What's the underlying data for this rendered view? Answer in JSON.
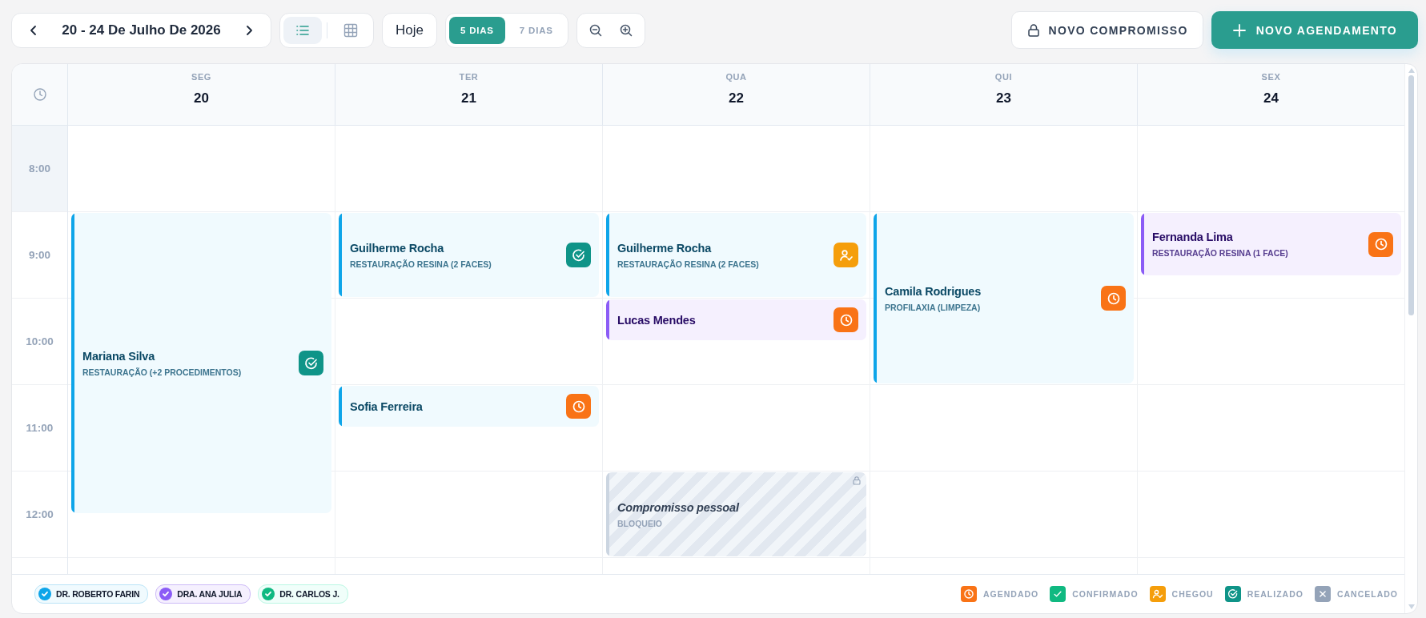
{
  "toolbar": {
    "range_label": "20 - 24 De Julho De 2026",
    "view_modes": [
      {
        "kind": "list",
        "selected": true
      },
      {
        "kind": "grid",
        "selected": false
      }
    ],
    "today_button": "Hoje",
    "day_spans": [
      {
        "label": "5 DIAS",
        "selected": true
      },
      {
        "label": "7 DIAS",
        "selected": false
      }
    ],
    "new_commitment_button": "NOVO COMPROMISSO",
    "new_appointment_button": "NOVO AGENDAMENTO"
  },
  "days": [
    {
      "weekday": "SEG",
      "date": "20",
      "quarters": [
        {
          "kind": "free"
        },
        {
          "kind": "free"
        },
        {
          "kind": "free"
        },
        {
          "kind": "free"
        },
        {
          "kind": "start"
        },
        {
          "kind": "cont"
        },
        {
          "kind": "cont"
        },
        {
          "kind": "cont"
        },
        {
          "kind": "cont"
        },
        {
          "kind": "cont"
        },
        {
          "kind": "cont"
        },
        {
          "kind": "cont"
        },
        {
          "kind": "cont"
        },
        {
          "kind": "cont"
        },
        {
          "kind": "cont"
        },
        {
          "kind": "cont"
        },
        {
          "kind": "cont"
        },
        {
          "kind": "cont"
        },
        {
          "kind": "free"
        },
        {
          "kind": "free"
        }
      ],
      "events": [
        {
          "kind": "appointment",
          "name": "Mariana Silva",
          "procedure": "RESTAURAÇÃO (+2 PROCEDIMENTOS)",
          "color": "#0ea5e9",
          "status": {
            "kind": "realizado"
          }
        }
      ]
    },
    {
      "weekday": "TER",
      "date": "21",
      "quarters": [
        {
          "kind": "free"
        },
        {
          "kind": "free"
        },
        {
          "kind": "free"
        },
        {
          "kind": "free"
        },
        {
          "kind": "start"
        },
        {
          "kind": "cont"
        },
        {
          "kind": "cont"
        },
        {
          "kind": "cont"
        },
        {
          "kind": "free"
        },
        {
          "kind": "free"
        },
        {
          "kind": "free"
        },
        {
          "kind": "free"
        },
        {
          "kind": "start"
        },
        {
          "kind": "cont"
        },
        {
          "kind": "free"
        },
        {
          "kind": "free"
        },
        {
          "kind": "free"
        },
        {
          "kind": "free"
        },
        {
          "kind": "free"
        },
        {
          "kind": "free"
        }
      ],
      "events": [
        {
          "kind": "appointment",
          "name": "Guilherme Rocha",
          "procedure": "RESTAURAÇÃO RESINA (2 FACES)",
          "color": "#0ea5e9",
          "status": {
            "kind": "realizado"
          }
        },
        {
          "kind": "appointment",
          "name": "Sofia Ferreira",
          "color": "#0ea5e9",
          "status": {
            "kind": "agendado"
          }
        }
      ]
    },
    {
      "weekday": "QUA",
      "date": "22",
      "quarters": [
        {
          "kind": "free"
        },
        {
          "kind": "free"
        },
        {
          "kind": "free"
        },
        {
          "kind": "free"
        },
        {
          "kind": "start"
        },
        {
          "kind": "cont"
        },
        {
          "kind": "cont"
        },
        {
          "kind": "cont"
        },
        {
          "kind": "start"
        },
        {
          "kind": "cont"
        },
        {
          "kind": "free"
        },
        {
          "kind": "free"
        },
        {
          "kind": "free"
        },
        {
          "kind": "free"
        },
        {
          "kind": "free"
        },
        {
          "kind": "free"
        },
        {
          "kind": "start"
        },
        {
          "kind": "cont"
        },
        {
          "kind": "cont"
        },
        {
          "kind": "cont"
        }
      ],
      "events": [
        {
          "kind": "appointment",
          "name": "Guilherme Rocha",
          "procedure": "RESTAURAÇÃO RESINA (2 FACES)",
          "color": "#0ea5e9",
          "status": {
            "kind": "chegou"
          }
        },
        {
          "kind": "appointment",
          "name": "Lucas Mendes",
          "color": "#8b5cf6",
          "status": {
            "kind": "agendado"
          }
        },
        {
          "kind": "block",
          "name": "Compromisso pessoal",
          "procedure": "BLOQUEIO"
        }
      ]
    },
    {
      "weekday": "QUI",
      "date": "23",
      "quarters": [
        {
          "kind": "free"
        },
        {
          "kind": "free"
        },
        {
          "kind": "free"
        },
        {
          "kind": "free"
        },
        {
          "kind": "start"
        },
        {
          "kind": "cont"
        },
        {
          "kind": "cont"
        },
        {
          "kind": "cont"
        },
        {
          "kind": "cont"
        },
        {
          "kind": "cont"
        },
        {
          "kind": "cont"
        },
        {
          "kind": "cont"
        },
        {
          "kind": "free"
        },
        {
          "kind": "free"
        },
        {
          "kind": "free"
        },
        {
          "kind": "free"
        },
        {
          "kind": "free"
        },
        {
          "kind": "free"
        },
        {
          "kind": "free"
        },
        {
          "kind": "free"
        }
      ],
      "events": [
        {
          "kind": "appointment",
          "name": "Camila Rodrigues",
          "procedure": "PROFILAXIA (LIMPEZA)",
          "color": "#0ea5e9",
          "status": {
            "kind": "agendado"
          }
        }
      ]
    },
    {
      "weekday": "SEX",
      "date": "24",
      "quarters": [
        {
          "kind": "free"
        },
        {
          "kind": "free"
        },
        {
          "kind": "free"
        },
        {
          "kind": "free"
        },
        {
          "kind": "start"
        },
        {
          "kind": "cont"
        },
        {
          "kind": "cont"
        },
        {
          "kind": "free"
        },
        {
          "kind": "free"
        },
        {
          "kind": "free"
        },
        {
          "kind": "free"
        },
        {
          "kind": "free"
        },
        {
          "kind": "free"
        },
        {
          "kind": "free"
        },
        {
          "kind": "free"
        },
        {
          "kind": "free"
        },
        {
          "kind": "free"
        },
        {
          "kind": "free"
        },
        {
          "kind": "free"
        },
        {
          "kind": "free"
        }
      ],
      "events": [
        {
          "kind": "appointment",
          "name": "Fernanda Lima",
          "procedure": "RESTAURAÇÃO RESINA (1 FACE)",
          "color": "#8b5cf6",
          "status": {
            "kind": "agendado"
          }
        }
      ]
    }
  ],
  "hours": [
    "8:00",
    "9:00",
    "10:00",
    "11:00",
    "12:00"
  ],
  "professionals": [
    {
      "name": "DR. ROBERTO FARIN",
      "color": "#0ea5e9",
      "checked": true
    },
    {
      "name": "DRA. ANA JULIA",
      "color": "#8b5cf6",
      "checked": true
    },
    {
      "name": "DR. CARLOS J.",
      "color": "#10b981",
      "checked": true
    }
  ],
  "status_legend": [
    {
      "kind": "agendado",
      "label": "AGENDADO"
    },
    {
      "kind": "confirmado",
      "label": "CONFIRMADO"
    },
    {
      "kind": "chegou",
      "label": "CHEGOU"
    },
    {
      "kind": "realizado",
      "label": "REALIZADO"
    },
    {
      "kind": "cancelado",
      "label": "CANCELADO"
    }
  ]
}
